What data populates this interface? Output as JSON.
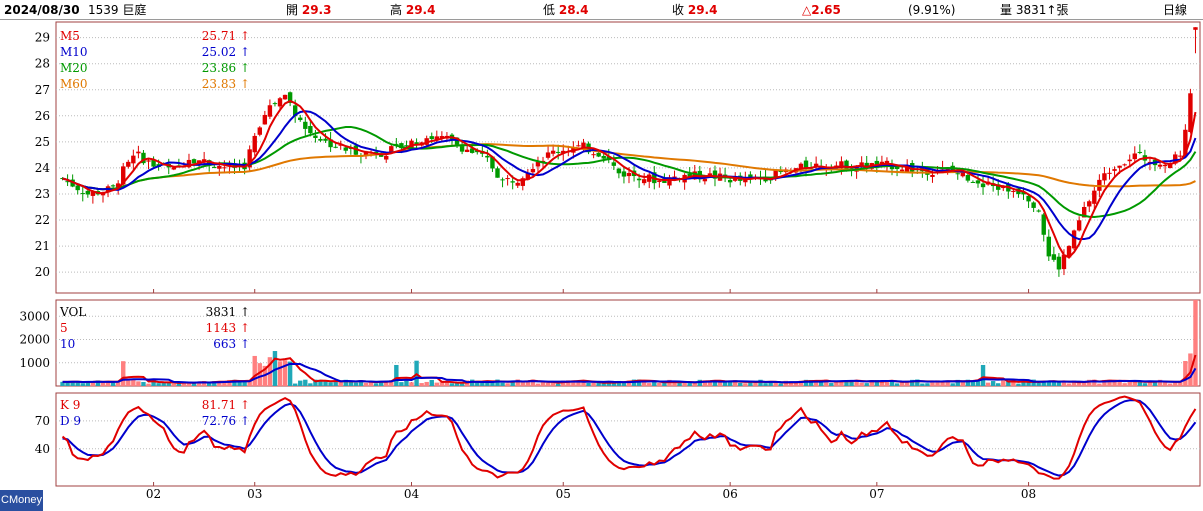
{
  "header": {
    "date": "2024/08/30",
    "stock": "1539 巨庭",
    "open_label": "開",
    "open": "29.3",
    "high_label": "高",
    "high": "29.4",
    "low_label": "低",
    "low": "28.4",
    "close_label": "收",
    "close": "29.4",
    "change": "△2.65",
    "change_pct": "(9.91%)",
    "volume_label": "量",
    "volume": "3831",
    "unit": "張",
    "period": "日線"
  },
  "brand": "CMoney",
  "colors": {
    "up": "#e00000",
    "down": "#009900",
    "ma5": "#e00000",
    "ma10": "#0000cc",
    "ma20": "#009900",
    "ma60": "#e07800",
    "volume_up": "#ff7f7f",
    "volume_down": "#1fa8b8"
  },
  "legends": {
    "price": [
      {
        "name": "M5",
        "value": "25.71"
      },
      {
        "name": "M10",
        "value": "25.02"
      },
      {
        "name": "M20",
        "value": "23.86"
      },
      {
        "name": "M60",
        "value": "23.83"
      }
    ],
    "volume": [
      {
        "name": "VOL",
        "value": "3831"
      },
      {
        "name": "5",
        "value": "1143"
      },
      {
        "name": "10",
        "value": "663"
      }
    ],
    "kd": [
      {
        "name": "K 9",
        "value": "81.71"
      },
      {
        "name": "D 9",
        "value": "72.76"
      }
    ],
    "arrow": "↑"
  },
  "chart_data": {
    "type": "candlestick",
    "price_axis": {
      "min": 19.2,
      "max": 29.6,
      "ticks": [
        "20",
        "21",
        "22",
        "23",
        "24",
        "25",
        "26",
        "27",
        "28",
        "29"
      ]
    },
    "volume_axis": {
      "min": 0,
      "max": 3700,
      "ticks": [
        "1000",
        "2000",
        "3000"
      ]
    },
    "kd_axis": {
      "min": 0,
      "max": 100,
      "ticks": [
        "40",
        "70"
      ]
    },
    "x_ticks": [
      {
        "label": "02",
        "index": 18
      },
      {
        "label": "03",
        "index": 38
      },
      {
        "label": "04",
        "index": 69
      },
      {
        "label": "05",
        "index": 99
      },
      {
        "label": "06",
        "index": 132
      },
      {
        "label": "07",
        "index": 161
      },
      {
        "label": "08",
        "index": 191
      }
    ],
    "grid": true,
    "series_count": 225
  }
}
